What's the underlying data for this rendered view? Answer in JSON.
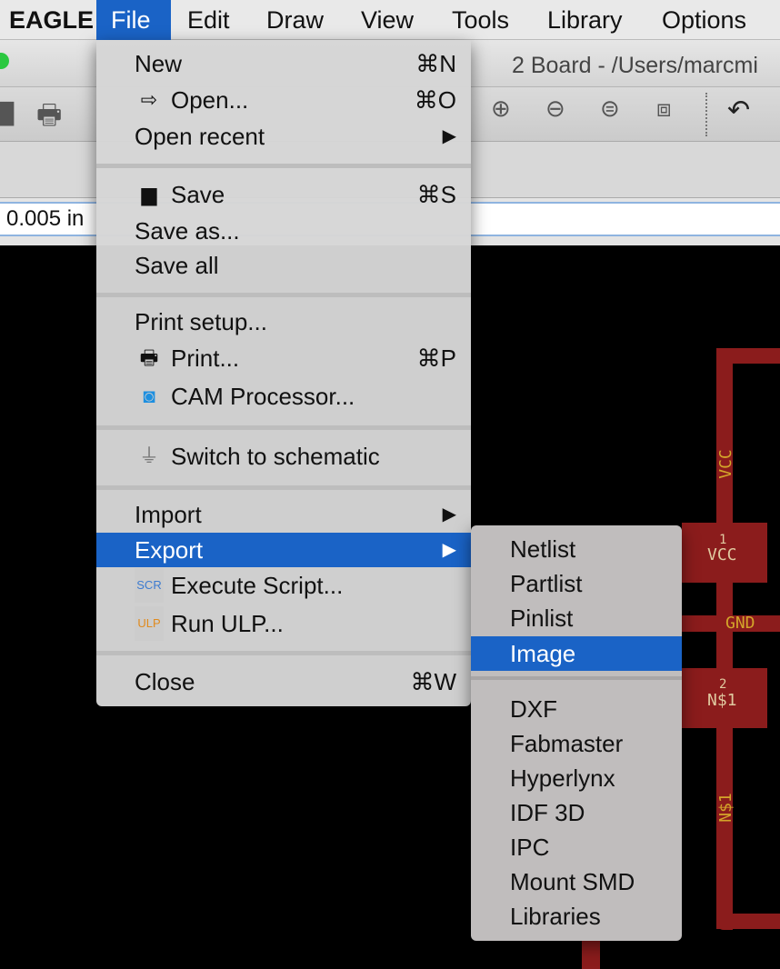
{
  "menubar": {
    "app": "EAGLE",
    "items": [
      "File",
      "Edit",
      "Draw",
      "View",
      "Tools",
      "Library",
      "Options"
    ],
    "active": "File"
  },
  "window": {
    "title": "2 Board - /Users/marcmi"
  },
  "coord_field": {
    "value": "0.005 in"
  },
  "file_menu": {
    "items": [
      {
        "label": "New",
        "shortcut": "⌘N"
      },
      {
        "label": "Open...",
        "shortcut": "⌘O",
        "icon": "open-icon"
      },
      {
        "label": "Open recent",
        "submenu": true
      },
      {
        "label": "Save",
        "shortcut": "⌘S",
        "icon": "floppy-icon"
      },
      {
        "label": "Save as..."
      },
      {
        "label": "Save all"
      },
      {
        "label": "Print setup..."
      },
      {
        "label": "Print...",
        "shortcut": "⌘P",
        "icon": "printer-icon"
      },
      {
        "label": "CAM Processor...",
        "icon": "camera-icon"
      },
      {
        "label": "Switch to schematic",
        "icon": "switch-icon"
      },
      {
        "label": "Import",
        "submenu": true
      },
      {
        "label": "Export",
        "submenu": true,
        "highlighted": true
      },
      {
        "label": "Execute Script...",
        "icon": "script-icon",
        "icon_text": "SCR"
      },
      {
        "label": "Run ULP...",
        "icon": "ulp-icon",
        "icon_text": "ULP"
      },
      {
        "label": "Close",
        "shortcut": "⌘W"
      }
    ]
  },
  "export_menu": {
    "items": [
      "Netlist",
      "Partlist",
      "Pinlist",
      "Image",
      "DXF",
      "Fabmaster",
      "Hyperlynx",
      "IDF 3D",
      "IPC",
      "Mount SMD",
      "Libraries"
    ],
    "highlighted": "Image"
  },
  "board": {
    "labels": {
      "vcc_trace": "VCC",
      "pad1_num": "1",
      "pad1_name": "VCC",
      "gnd": "GND",
      "pad2_num": "2",
      "pad2_name": "N$1",
      "n1_trace": "N$1"
    },
    "trace_color": "#8b1c1c",
    "text_color": "#d4a52a"
  },
  "colors": {
    "highlight": "#1a63c6"
  }
}
